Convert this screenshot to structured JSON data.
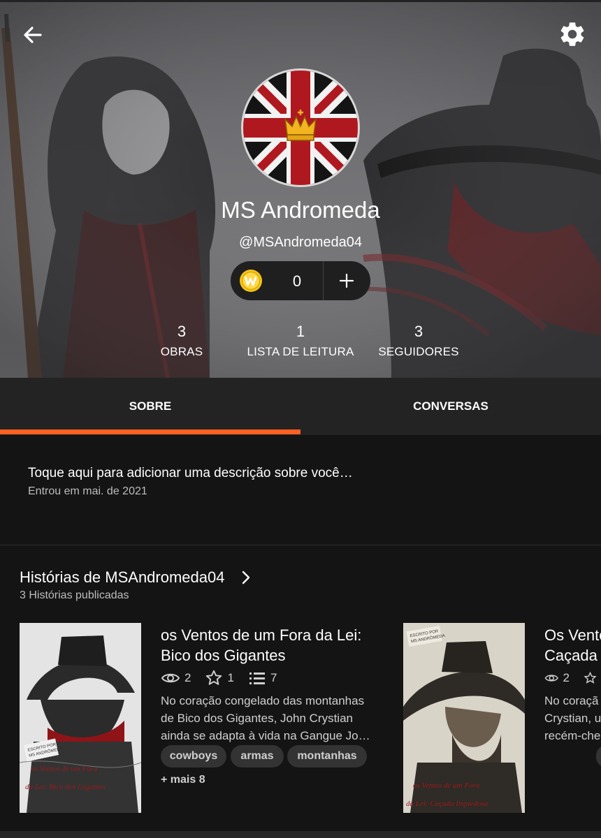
{
  "profile": {
    "name": "MS Andromeda",
    "handle": "@MSAndromeda04",
    "coins": "0",
    "accent_color": "#ff6122"
  },
  "stats": [
    {
      "value": "3",
      "label": "OBRAS"
    },
    {
      "value": "1",
      "label": "LISTA DE LEITURA"
    },
    {
      "value": "3",
      "label": "SEGUIDORES"
    }
  ],
  "tabs": [
    {
      "label": "SOBRE",
      "active": true
    },
    {
      "label": "CONVERSAS",
      "active": false
    }
  ],
  "about": {
    "description": "Toque aqui para adicionar uma descrição sobre você…",
    "joined": "Entrou em mai. de 2021"
  },
  "stories_section": {
    "title": "Histórias de MSAndromeda04",
    "count": "3 Histórias publicadas"
  },
  "stories": [
    {
      "title_line1": "os Ventos de um Fora da Lei:",
      "title_line2": "Bico dos Gigantes",
      "reads": "2",
      "votes": "1",
      "parts": "7",
      "desc_line1": "No coração congelado das montanhas",
      "desc_line2": "de Bico dos Gigantes, John Crystian",
      "desc_line3": "ainda se adapta à vida na Gangue Jo…",
      "tags": [
        "cowboys",
        "armas",
        "montanhas"
      ],
      "more_tags": "+ mais 8",
      "cover_credit_1": "ESCRITO POR",
      "cover_credit_2": "MS ANDRÔMEDA",
      "cover_title_1": "os Ventos de um Fora",
      "cover_title_2": "da Lei: Bico dos Gigantes"
    },
    {
      "title_line1": "Os Vento",
      "title_line2": "Caçada",
      "reads": "2",
      "desc_line1": "No coraçã",
      "desc_line2": "Crystian, u",
      "desc_line3": "recém-che",
      "cover_credit_1": "ESCRITO POR",
      "cover_credit_2": "MS ANDRÔMEDA",
      "cover_title_1": "os Ventos de um Fora",
      "cover_title_2": "da Lei: Caçada Impiedosa"
    }
  ],
  "icons": {
    "back": "arrow-left-icon",
    "settings": "gear-icon",
    "coin": "wattpad-coin-icon",
    "add": "plus-icon",
    "reads": "eye-icon",
    "votes": "star-icon",
    "parts": "list-icon",
    "more": "chevron-right-icon"
  }
}
